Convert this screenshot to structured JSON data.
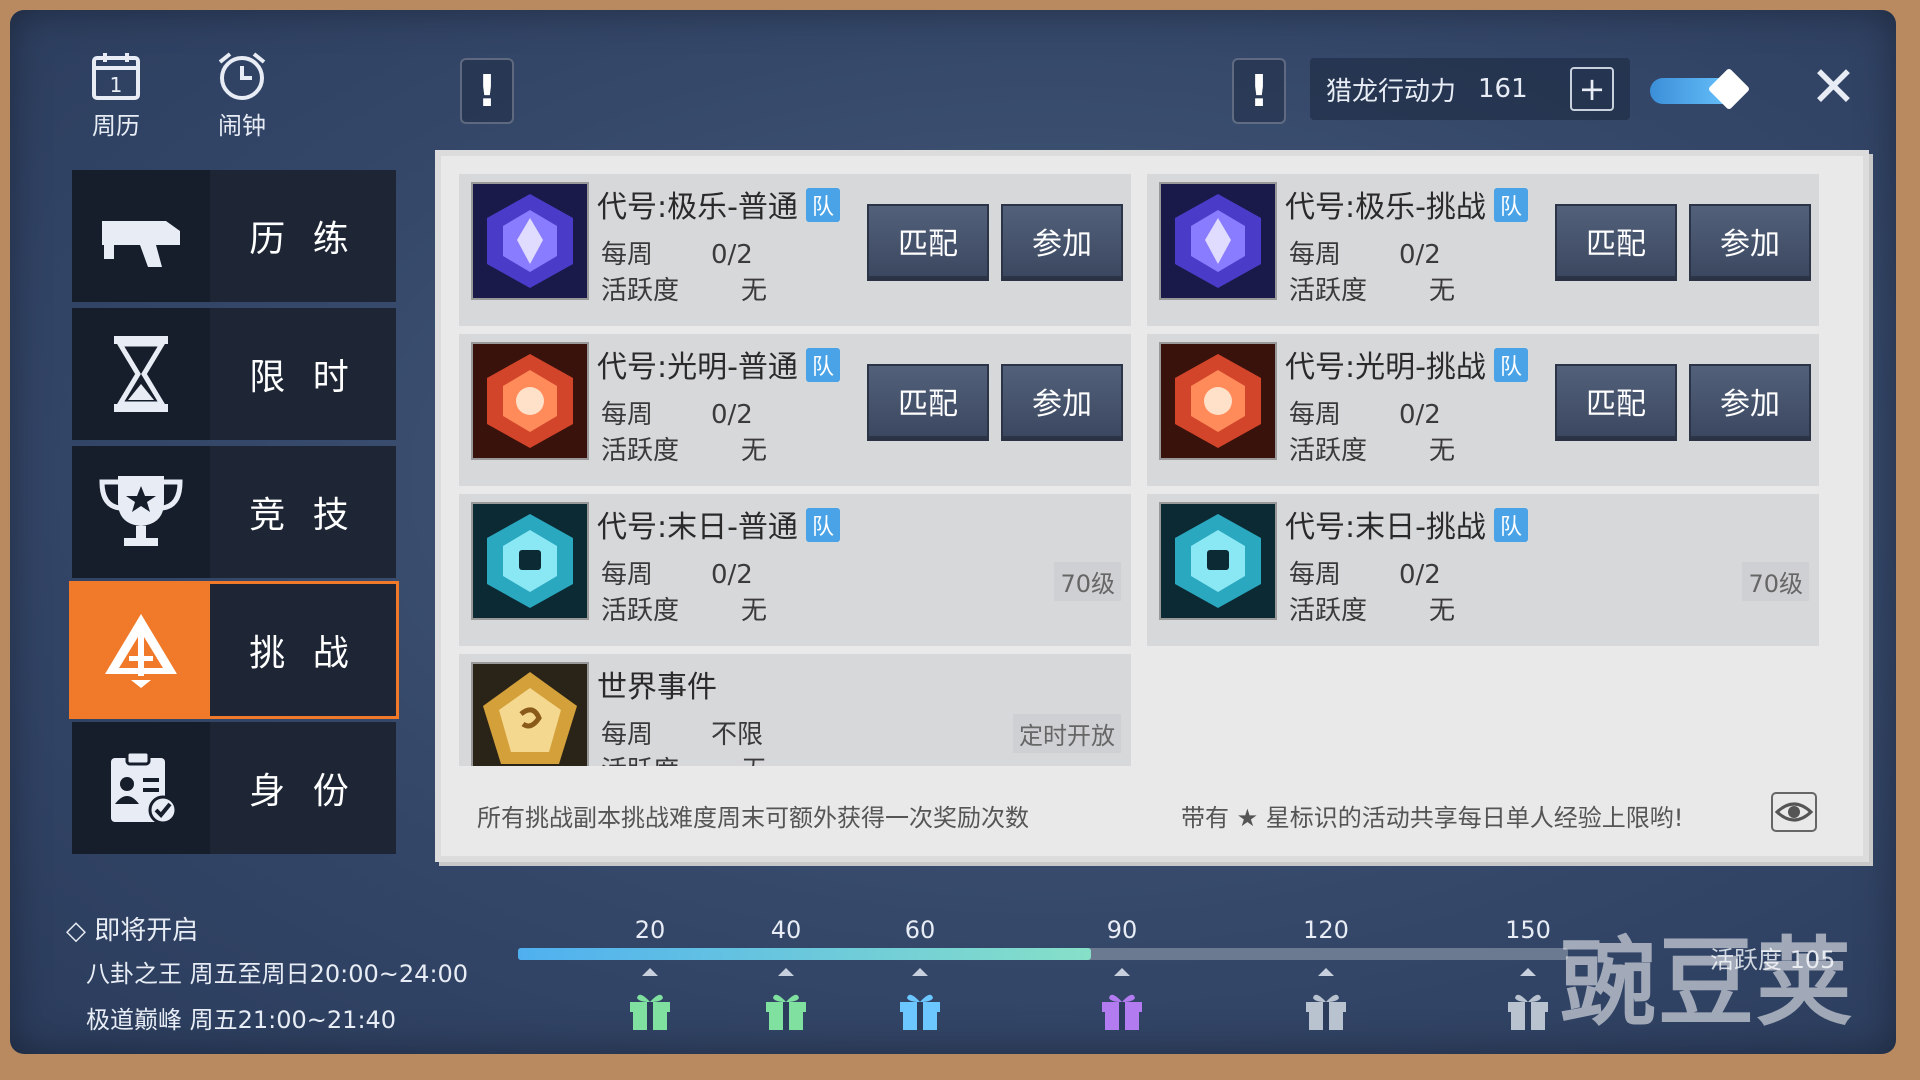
{
  "topbar": {
    "calendar_label": "周历",
    "alarm_label": "闹钟",
    "energy_label": "猎龙行动力",
    "energy_value": "161",
    "plus": "+",
    "close": "✕",
    "toggle_on": true
  },
  "sidebar": {
    "items": [
      {
        "label": "历 练",
        "icon": "gun-icon"
      },
      {
        "label": "限 时",
        "icon": "hourglass-icon"
      },
      {
        "label": "竞 技",
        "icon": "trophy-icon"
      },
      {
        "label": "挑 战",
        "icon": "sword-triangle-icon",
        "active": true
      },
      {
        "label": "身 份",
        "icon": "id-clipboard-icon"
      }
    ]
  },
  "panel": {
    "cards": [
      {
        "title": "代号:极乐-普通",
        "team": "队",
        "weekly_k": "每周",
        "weekly_v": "0/2",
        "active_k": "活跃度",
        "active_v": "无",
        "match": "匹配",
        "join": "参加",
        "color": "#4a3cc8"
      },
      {
        "title": "代号:极乐-挑战",
        "team": "队",
        "weekly_k": "每周",
        "weekly_v": "0/2",
        "active_k": "活跃度",
        "active_v": "无",
        "match": "匹配",
        "join": "参加",
        "color": "#4a3cc8"
      },
      {
        "title": "代号:光明-普通",
        "team": "队",
        "weekly_k": "每周",
        "weekly_v": "0/2",
        "active_k": "活跃度",
        "active_v": "无",
        "match": "匹配",
        "join": "参加",
        "color": "#d2452a"
      },
      {
        "title": "代号:光明-挑战",
        "team": "队",
        "weekly_k": "每周",
        "weekly_v": "0/2",
        "active_k": "活跃度",
        "active_v": "无",
        "match": "匹配",
        "join": "参加",
        "color": "#d2452a"
      },
      {
        "title": "代号:末日-普通",
        "team": "队",
        "weekly_k": "每周",
        "weekly_v": "0/2",
        "active_k": "活跃度",
        "active_v": "无",
        "level": "70级",
        "color": "#2aa8c0"
      },
      {
        "title": "代号:末日-挑战",
        "team": "队",
        "weekly_k": "每周",
        "weekly_v": "0/2",
        "active_k": "活跃度",
        "active_v": "无",
        "level": "70级",
        "color": "#2aa8c0"
      },
      {
        "title": "世界事件",
        "weekly_k": "每周",
        "weekly_v": "不限",
        "active_k": "活跃度",
        "active_v": "无",
        "level": "定时开放",
        "color": "#d4a03a"
      }
    ],
    "note_left": "所有挑战副本挑战难度周末可额外获得一次奖励次数",
    "note_right": "带有 ★ 星标识的活动共享每日单人经验上限哟!"
  },
  "bottom": {
    "soon_title": "即将开启",
    "soon_items": [
      "八卦之王 周五至周日20:00~24:00",
      "极道巅峰 周五21:00~21:40"
    ],
    "progress_ticks": [
      "20",
      "40",
      "60",
      "90",
      "120",
      "150"
    ],
    "progress_value": 105,
    "progress_max": 150,
    "activity_label": "活跃度",
    "activity_value": "105",
    "watermark": "豌豆荚"
  }
}
